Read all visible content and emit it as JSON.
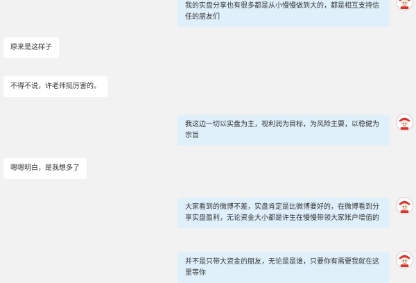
{
  "messages": [
    {
      "side": "outgoing",
      "text": "我的实盘分享也有很多都是从小慢慢做到大的，都是相互支持信任的朋友们"
    },
    {
      "side": "incoming",
      "text": "原来是这样子"
    },
    {
      "side": "incoming",
      "text": "不得不说，许老师挺厉害的。"
    },
    {
      "side": "outgoing",
      "text": "我这边一切以实盘为主，视利润为目标，为风险主要，以稳健为宗旨"
    },
    {
      "side": "incoming",
      "text": "嗯嗯明白，是我想多了"
    },
    {
      "side": "outgoing",
      "text": "大家看到的微博不差，实盘肯定是比微博要好的，在微博看到分享实盘盈利，无论资金大小都是许生在慢慢带领大家账户增值的"
    },
    {
      "side": "outgoing",
      "text": "并不是只带大资金的朋友，无论是是谁，只要你有需要我就在这里等你"
    }
  ],
  "colors": {
    "background": "#f2f2f2",
    "incoming_bubble": "#ffffff",
    "outgoing_bubble": "#dff0fb",
    "avatar_accent": "#d9322b"
  },
  "avatar": {
    "icon": "mascot-avatar-icon"
  }
}
